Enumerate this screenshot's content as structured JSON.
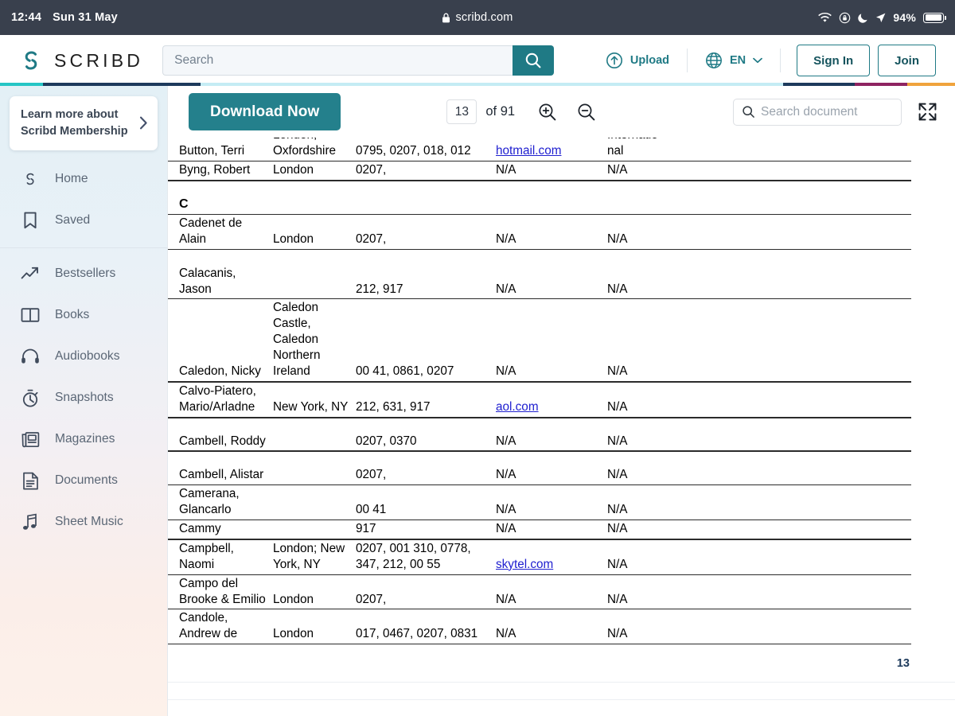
{
  "status_bar": {
    "time": "12:44",
    "date": "Sun 31 May",
    "battery_pct": "94%",
    "icons": [
      "wifi-icon",
      "rotation-lock-icon",
      "moon-icon",
      "location-arrow-icon",
      "battery-icon"
    ]
  },
  "url_bar": {
    "lock": "🔒",
    "domain": "scribd.com"
  },
  "header": {
    "brand": "SCRIBD",
    "search_placeholder": "Search",
    "search_value": "",
    "upload_label": "Upload",
    "language_label": "EN",
    "sign_in_label": "Sign In",
    "join_label": "Join"
  },
  "sidebar": {
    "promo": {
      "line1": "Learn more about",
      "line2": "Scribd Membership"
    },
    "items": [
      {
        "label": "Home",
        "icon": "scribd-logo-icon"
      },
      {
        "label": "Saved",
        "icon": "bookmark-icon"
      },
      {
        "label": "Bestsellers",
        "icon": "trending-up-icon"
      },
      {
        "label": "Books",
        "icon": "open-book-icon"
      },
      {
        "label": "Audiobooks",
        "icon": "headphones-icon"
      },
      {
        "label": "Snapshots",
        "icon": "stopwatch-icon"
      },
      {
        "label": "Magazines",
        "icon": "magazine-icon"
      },
      {
        "label": "Documents",
        "icon": "document-icon"
      },
      {
        "label": "Sheet Music",
        "icon": "music-note-icon"
      }
    ]
  },
  "toolbar": {
    "download_label": "Download Now",
    "current_page": "13",
    "total_pages": "of 91",
    "zoom_in_icon": "zoom-in-icon",
    "zoom_out_icon": "zoom-out-icon",
    "doc_search_placeholder": "Search document",
    "doc_search_value": "",
    "fullscreen_icon": "fullscreen-icon"
  },
  "document": {
    "page_number": "13",
    "rows": [
      {
        "type": "data",
        "name": "Button, Terri",
        "loc": "London;\nOxfordshire",
        "phone": "0795, 0207, 018, 012",
        "email": "hotmail.com",
        "email_link": true,
        "extra": "Internatio\nnal"
      },
      {
        "type": "data",
        "name": "Byng, Robert",
        "loc": "London",
        "phone": "0207,",
        "email": "N/A",
        "email_link": false,
        "extra": "N/A"
      },
      {
        "type": "spacer"
      },
      {
        "type": "section",
        "letter": "C"
      },
      {
        "type": "data",
        "name": "Cadenet de\nAlain",
        "loc": "London",
        "phone": "0207,",
        "email": "N/A",
        "email_link": false,
        "extra": "N/A"
      },
      {
        "type": "spacer"
      },
      {
        "type": "data",
        "name": "Calacanis, Jason",
        "loc": "",
        "phone": "212, 917",
        "email": "N/A",
        "email_link": false,
        "extra": "N/A"
      },
      {
        "type": "data",
        "name": "Caledon, Nicky",
        "loc": "Caledon\nCastle,\nCaledon\nNorthern\nIreland",
        "phone": "00 41, 0861, 0207",
        "email": "N/A",
        "email_link": false,
        "extra": "N/A"
      },
      {
        "type": "data",
        "name": "Calvo-Piatero,\nMario/Arladne",
        "loc": "New York, NY",
        "phone": "212, 631, 917",
        "email": "aol.com",
        "email_link": true,
        "extra": "N/A"
      },
      {
        "type": "spacer"
      },
      {
        "type": "data",
        "name": "Cambell, Roddy",
        "loc": "",
        "phone": "0207, 0370",
        "email": "N/A",
        "email_link": false,
        "extra": "N/A"
      },
      {
        "type": "spacer"
      },
      {
        "type": "data",
        "name": "Cambell, Alistar",
        "loc": "",
        "phone": "0207,",
        "email": "N/A",
        "email_link": false,
        "extra": "N/A"
      },
      {
        "type": "data",
        "name": "Camerana,\nGlancarlo",
        "loc": "",
        "phone": "00 41",
        "email": "N/A",
        "email_link": false,
        "extra": "N/A"
      },
      {
        "type": "data",
        "name": "Cammy",
        "loc": "",
        "phone": "917",
        "email": "N/A",
        "email_link": false,
        "extra": "N/A"
      },
      {
        "type": "data",
        "name": "Campbell,\nNaomi",
        "loc": "London; New\nYork, NY",
        "phone": "0207, 001 310, 0778,\n347, 212, 00 55",
        "email": "skytel.com",
        "email_link": true,
        "extra": "N/A"
      },
      {
        "type": "data",
        "name": "Campo del\nBrooke & Emilio",
        "loc": "London",
        "phone": "0207,",
        "email": "N/A",
        "email_link": false,
        "extra": "N/A"
      },
      {
        "type": "data",
        "name": "Candole,\nAndrew de",
        "loc": "London",
        "phone": "017, 0467, 0207, 0831",
        "email": "N/A",
        "email_link": false,
        "extra": "N/A"
      }
    ]
  },
  "colors": {
    "teal": "#1f7a85",
    "download_teal": "#24808c",
    "navy": "#1d3a5c",
    "status_bar": "#39404d",
    "link_blue": "#2020d0"
  }
}
